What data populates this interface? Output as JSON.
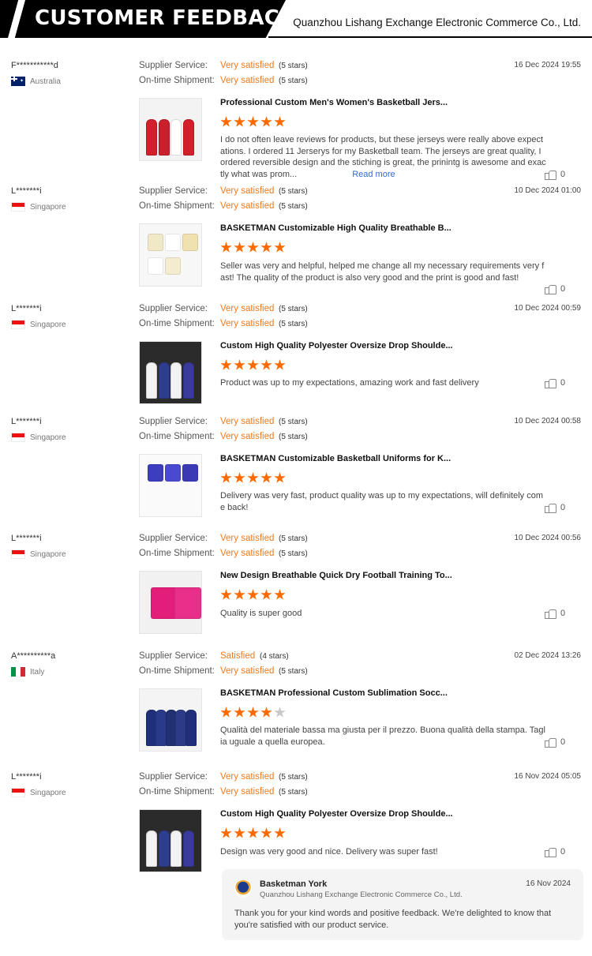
{
  "header": {
    "title": "CUSTOMER FEEDBACK",
    "company": "Quanzhou Lishang Exchange Electronic Commerce Co., Ltd."
  },
  "labels": {
    "supplier_service": "Supplier Service:",
    "on_time_shipment": "On-time Shipment:",
    "read_more": "Read more"
  },
  "reviews": [
    {
      "user": "F***********d",
      "country": "Australia",
      "flag": "au",
      "date": "16 Dec 2024 19:55",
      "supplier_rating": "Very satisfied",
      "supplier_stars": "(5 stars)",
      "shipment_rating": "Very satisfied",
      "shipment_stars": "(5 stars)",
      "product_title": "Professional Custom Men's Women's Basketball Jers...",
      "rating": 5,
      "text": "I do not often leave reviews for products, but these jerseys were really above expectations.  I ordered 11 Jerserys for my Basketball team. The jerseys are great quality, I ordered reversible design and the stiching is great, the prinintg is awesome and exactly what was prom...",
      "likes": "0"
    },
    {
      "user": "L*******i",
      "country": "Singapore",
      "flag": "sg",
      "date": "10 Dec 2024 01:00",
      "supplier_rating": "Very satisfied",
      "supplier_stars": "(5 stars)",
      "shipment_rating": "Very satisfied",
      "shipment_stars": "(5 stars)",
      "product_title": "BASKETMAN Customizable High Quality Breathable B...",
      "rating": 5,
      "text": "Seller was very and helpful, helped me change all my necessary requirements very fast! The quality of the product is also very good and the print is good and fast!",
      "likes": "0"
    },
    {
      "user": "L*******i",
      "country": "Singapore",
      "flag": "sg",
      "date": "10 Dec 2024 00:59",
      "supplier_rating": "Very satisfied",
      "supplier_stars": "(5 stars)",
      "shipment_rating": "Very satisfied",
      "shipment_stars": "(5 stars)",
      "product_title": "Custom High Quality Polyester Oversize Drop Shoulde...",
      "rating": 5,
      "text": "Product was up to my expectations, amazing work and fast delivery",
      "likes": "0"
    },
    {
      "user": "L*******i",
      "country": "Singapore",
      "flag": "sg",
      "date": "10 Dec 2024 00:58",
      "supplier_rating": "Very satisfied",
      "supplier_stars": "(5 stars)",
      "shipment_rating": "Very satisfied",
      "shipment_stars": "(5 stars)",
      "product_title": "BASKETMAN Customizable Basketball Uniforms for K...",
      "rating": 5,
      "text": "Delivery was very fast, product quality was up to my expectations, will definitely come back!",
      "likes": "0"
    },
    {
      "user": "L*******i",
      "country": "Singapore",
      "flag": "sg",
      "date": "10 Dec 2024 00:56",
      "supplier_rating": "Very satisfied",
      "supplier_stars": "(5 stars)",
      "shipment_rating": "Very satisfied",
      "shipment_stars": "(5 stars)",
      "product_title": "New Design Breathable Quick Dry Football Training To...",
      "rating": 5,
      "text": "Quality is super good",
      "likes": "0"
    },
    {
      "user": "A**********a",
      "country": "Italy",
      "flag": "it",
      "date": "02 Dec 2024 13:26",
      "supplier_rating": "Satisfied",
      "supplier_stars": "(4 stars)",
      "shipment_rating": "Very satisfied",
      "shipment_stars": "(5 stars)",
      "product_title": "BASKETMAN Professional Custom Sublimation Socc...",
      "rating": 4,
      "text": "Qualità del materiale bassa ma giusta per il prezzo. Buona qualità della stampa. Taglia uguale a quella europea.",
      "likes": "0"
    },
    {
      "user": "L*******i",
      "country": "Singapore",
      "flag": "sg",
      "date": "16 Nov 2024 05:05",
      "supplier_rating": "Very satisfied",
      "supplier_stars": "(5 stars)",
      "shipment_rating": "Very satisfied",
      "shipment_stars": "(5 stars)",
      "product_title": "Custom High Quality Polyester Oversize Drop Shoulde...",
      "rating": 5,
      "text": "Design was very good and nice. Delivery was super fast!",
      "likes": "0"
    }
  ],
  "reply": {
    "name": "Basketman York",
    "company": "Quanzhou Lishang Exchange Electronic Commerce Co., Ltd.",
    "date": "16 Nov 2024",
    "text": "Thank you for your kind words and positive feedback. We're delighted to know that you're satisfied with our product service."
  }
}
